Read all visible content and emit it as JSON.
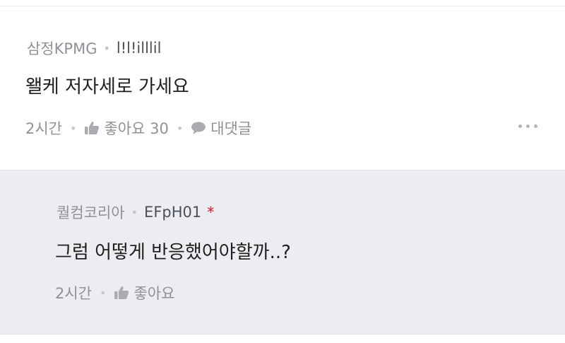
{
  "comments": [
    {
      "company": "삼정KPMG",
      "nickname": "l!l!illlil",
      "body": "왤케 저자세로 가세요",
      "time": "2시간",
      "like_label": "좋아요 30",
      "reply_label": "대댓글",
      "more_icon": "more-horizontal-icon"
    },
    {
      "company": "퀄컴코리아",
      "nickname": "EFpH01",
      "author_mark": "*",
      "body": "그럼 어떻게 반응했어야할까..?",
      "time": "2시간",
      "like_label": "좋아요"
    }
  ],
  "icons": {
    "like": "thumbs-up-icon",
    "reply": "speech-bubble-icon"
  },
  "colors": {
    "meta_text": "#8e9197",
    "reply_background": "#ecedf0",
    "author_mark": "#d0162a",
    "icon": "#a9abb0"
  }
}
